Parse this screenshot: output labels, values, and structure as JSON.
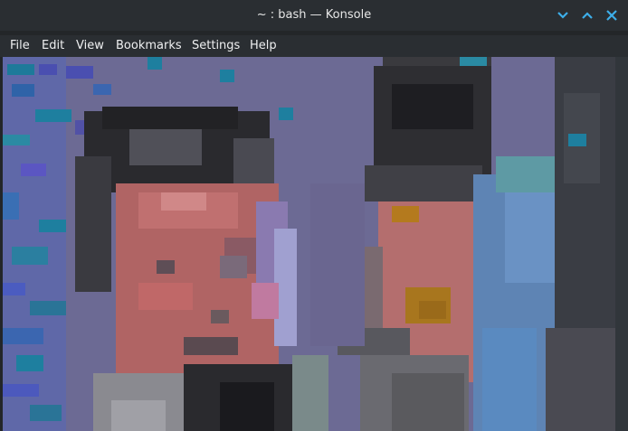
{
  "window": {
    "title": "~ : bash — Konsole",
    "accent": "#3daee9"
  },
  "menubar": {
    "items": [
      {
        "id": "file",
        "label": "File"
      },
      {
        "id": "edit",
        "label": "Edit"
      },
      {
        "id": "view",
        "label": "View"
      },
      {
        "id": "bookmarks",
        "label": "Bookmarks"
      },
      {
        "id": "settings",
        "label": "Settings"
      },
      {
        "id": "help",
        "label": "Help"
      }
    ]
  },
  "terminal": {
    "content": "pixelated-image-preview",
    "background": "#6c6a94"
  }
}
